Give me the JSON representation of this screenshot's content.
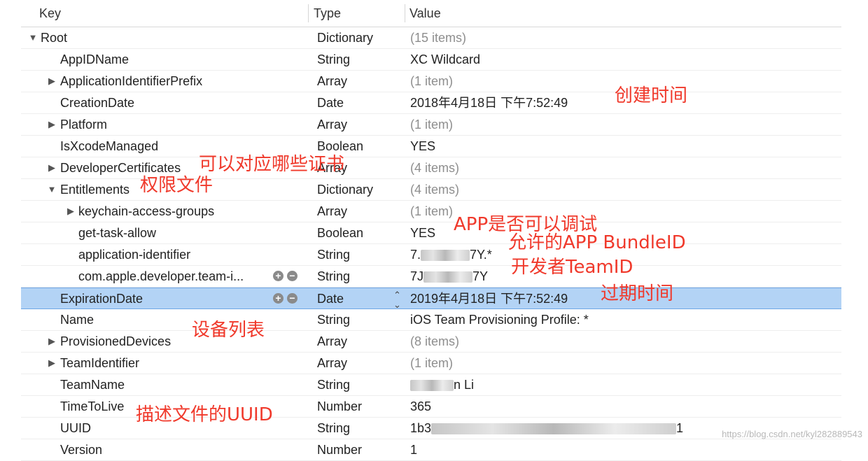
{
  "header": {
    "key": "Key",
    "type": "Type",
    "value": "Value"
  },
  "rows": [
    {
      "key": "Root",
      "type": "Dictionary",
      "value": "(15 items)"
    },
    {
      "key": "AppIDName",
      "type": "String",
      "value": "XC Wildcard"
    },
    {
      "key": "ApplicationIdentifierPrefix",
      "type": "Array",
      "value": "(1 item)"
    },
    {
      "key": "CreationDate",
      "type": "Date",
      "value": "2018年4月18日 下午7:52:49"
    },
    {
      "key": "Platform",
      "type": "Array",
      "value": "(1 item)"
    },
    {
      "key": "IsXcodeManaged",
      "type": "Boolean",
      "value": "YES"
    },
    {
      "key": "DeveloperCertificates",
      "type": "Array",
      "value": "(4 items)"
    },
    {
      "key": "Entitlements",
      "type": "Dictionary",
      "value": "(4 items)"
    },
    {
      "key": "keychain-access-groups",
      "type": "Array",
      "value": "(1 item)"
    },
    {
      "key": "get-task-allow",
      "type": "Boolean",
      "value": "YES"
    },
    {
      "key": "application-identifier",
      "type": "String",
      "value_start": "7.",
      "value_end": "7Y.*"
    },
    {
      "key": "com.apple.developer.team-i...",
      "type": "String",
      "value_start": "7J",
      "value_end": "7Y"
    },
    {
      "key": "ExpirationDate",
      "type": "Date",
      "value": "2019年4月18日 下午7:52:49"
    },
    {
      "key": "Name",
      "type": "String",
      "value": "iOS Team Provisioning Profile: *"
    },
    {
      "key": "ProvisionedDevices",
      "type": "Array",
      "value": "(8 items)"
    },
    {
      "key": "TeamIdentifier",
      "type": "Array",
      "value": "(1 item)"
    },
    {
      "key": "TeamName",
      "type": "String",
      "value_end": "n Li"
    },
    {
      "key": "TimeToLive",
      "type": "Number",
      "value": "365"
    },
    {
      "key": "UUID",
      "type": "String",
      "value_start": "1b3",
      "value_end": "1"
    },
    {
      "key": "Version",
      "type": "Number",
      "value": "1"
    }
  ],
  "annotations": {
    "creation": "创建时间",
    "certificates": "可以对应哪些证书",
    "entitlements": "权限文件",
    "debug": "APP是否可以调试",
    "bundle": "允许的APP BundleID",
    "team": "开发者TeamID",
    "expiration": "过期时间",
    "devices": "设备列表",
    "uuid": "描述文件的UUID"
  },
  "controls": {
    "add": "+",
    "remove": "−",
    "stepper": "⌃⌄"
  },
  "icons": {
    "expanded": "▼",
    "collapsed": "▶"
  },
  "watermark": "https://blog.csdn.net/kyl282889543",
  "colors": {
    "selection": "#b3d3f5",
    "annotation": "#f0392b"
  }
}
